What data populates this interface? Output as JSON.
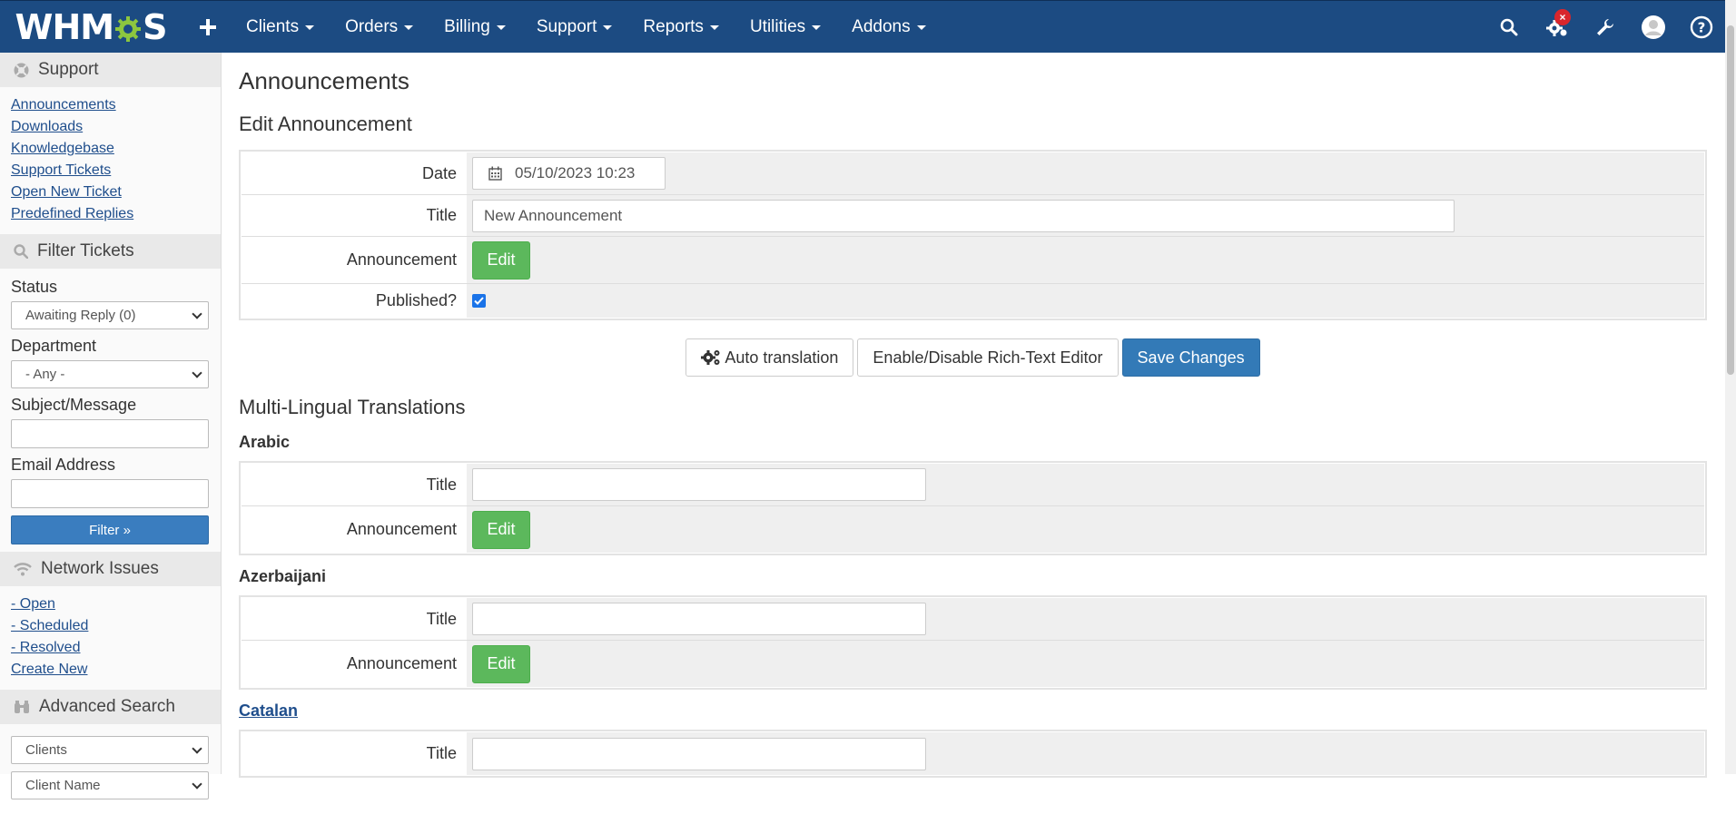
{
  "topbar": {
    "logo_pre": "WHM",
    "logo_post": "S",
    "nav": [
      {
        "label": "Clients"
      },
      {
        "label": "Orders"
      },
      {
        "label": "Billing"
      },
      {
        "label": "Support"
      },
      {
        "label": "Reports"
      },
      {
        "label": "Utilities"
      },
      {
        "label": "Addons"
      }
    ],
    "notification_badge": "×"
  },
  "sidebar": {
    "support_header": "Support",
    "support_links": [
      "Announcements",
      "Downloads",
      "Knowledgebase",
      "Support Tickets",
      "Open New Ticket",
      "Predefined Replies"
    ],
    "filter_header": "Filter Tickets",
    "status_label": "Status",
    "status_value": "Awaiting Reply (0)",
    "department_label": "Department",
    "department_value": "- Any -",
    "subject_label": "Subject/Message",
    "email_label": "Email Address",
    "filter_button": "Filter »",
    "network_header": "Network Issues",
    "network_links": [
      "- Open",
      "- Scheduled",
      "- Resolved",
      "Create New"
    ],
    "advanced_header": "Advanced Search",
    "advanced_select": "Clients",
    "advanced_select2": "Client Name"
  },
  "main": {
    "page_title": "Announcements",
    "edit_title": "Edit Announcement",
    "date_label": "Date",
    "date_value": "05/10/2023 10:23",
    "title_label": "Title",
    "title_value": "New Announcement",
    "announcement_label": "Announcement",
    "edit_button": "Edit",
    "published_label": "Published?",
    "published_checked": true,
    "buttons": {
      "auto_translation": "Auto translation",
      "rich_text": "Enable/Disable Rich-Text Editor",
      "save": "Save Changes"
    },
    "multilingual_title": "Multi-Lingual Translations",
    "languages": [
      {
        "name": "Arabic",
        "title_label": "Title",
        "announcement_label": "Announcement",
        "edit": "Edit"
      },
      {
        "name": "Azerbaijani",
        "title_label": "Title",
        "announcement_label": "Announcement",
        "edit": "Edit"
      },
      {
        "name": "Catalan",
        "title_label": "Title"
      }
    ]
  },
  "colors": {
    "navbar": "#1c4b82",
    "accent_green": "#5cb85c",
    "primary_blue": "#337ab7",
    "link": "#1f4e8c"
  }
}
